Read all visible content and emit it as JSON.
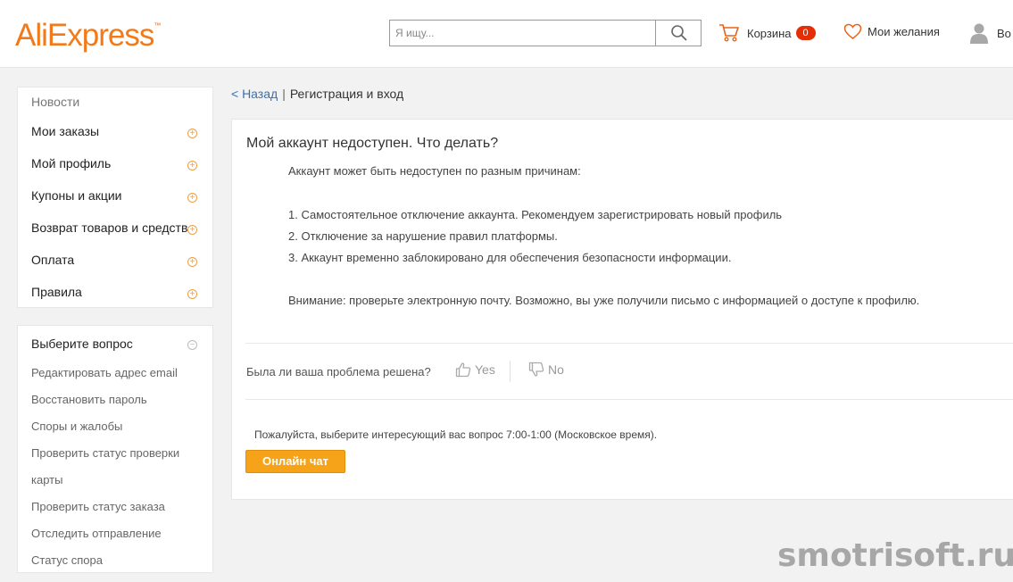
{
  "header": {
    "logo": "AliExpress",
    "logo_tm": "™",
    "search_placeholder": "Я ищу...",
    "cart_label": "Корзина",
    "cart_count": "0",
    "wishlist_label": "Мои желания",
    "user_label": "Во"
  },
  "sidebar": {
    "news": "Новости",
    "items": [
      {
        "label": "Мои заказы"
      },
      {
        "label": "Мой профиль"
      },
      {
        "label": "Купоны и акции"
      },
      {
        "label": "Возврат товаров и средств"
      },
      {
        "label": "Оплата"
      },
      {
        "label": "Правила"
      }
    ],
    "questions_title": "Выберите вопрос",
    "questions": [
      "Редактировать адрес email",
      "Восстановить пароль",
      "Споры и жалобы",
      "Проверить статус проверки",
      "карты",
      "Проверить статус заказа",
      "Отследить отправление",
      "Статус спора"
    ]
  },
  "breadcrumb": {
    "back": "< Назад",
    "current": "Регистрация и вход"
  },
  "article": {
    "title": "Мой аккаунт недоступен. Что делать?",
    "lines": [
      "Аккаунт может быть недоступен по разным причинам:",
      "1. Самостоятельное отключение аккаунта. Рекомендуем зарегистрировать новый профиль",
      "2. Отключение за нарушение правил платформы.",
      "3. Аккаунт временно заблокировано для обеспечения безопасности информации.",
      "Внимание: проверьте электронную почту. Возможно, вы уже получили письмо с информацией о доступе к профилю."
    ],
    "helpful_question": "Была ли ваша проблема решена?",
    "yes": "Yes",
    "no": "No",
    "note": "Пожалуйста, выберите интересующий вас вопрос 7:00-1:00 (Московское время).",
    "chat_button": "Онлайн чат"
  },
  "watermark": "smotrisoft.ru",
  "colors": {
    "accent": "#f7a31a",
    "brand": "#f27a1a",
    "badge": "#e62e04",
    "link": "#3a6fb0"
  }
}
